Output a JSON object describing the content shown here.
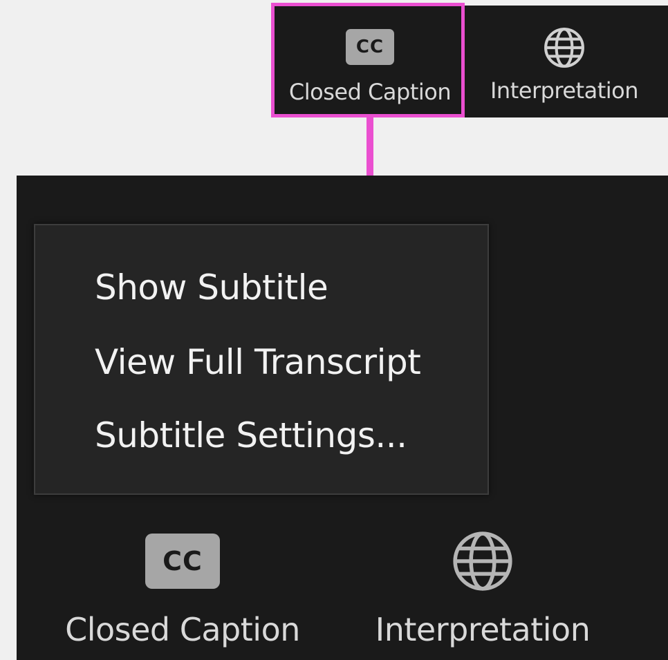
{
  "top_toolbar": {
    "closed_caption": {
      "badge": "CC",
      "label": "Closed Caption",
      "icon": "cc-icon"
    },
    "interpretation": {
      "label": "Interpretation",
      "icon": "globe-icon"
    }
  },
  "caption_menu": {
    "items": [
      {
        "label": "Show Subtitle"
      },
      {
        "label": "View Full Transcript"
      },
      {
        "label": "Subtitle Settings..."
      }
    ]
  },
  "bottom_toolbar": {
    "closed_caption": {
      "badge": "CC",
      "label": "Closed Caption",
      "icon": "cc-icon"
    },
    "interpretation": {
      "label": "Interpretation",
      "icon": "globe-icon"
    }
  },
  "colors": {
    "highlight": "#ea4fd0",
    "toolbar_bg": "#1a1a1a",
    "menu_bg": "#252525",
    "page_bg": "#f0f0f0"
  }
}
